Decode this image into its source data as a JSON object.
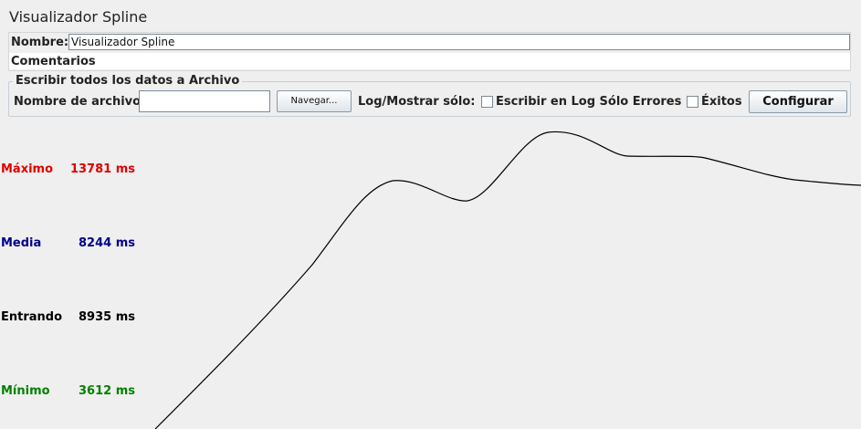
{
  "window": {
    "title": "Visualizador Spline"
  },
  "name_section": {
    "name_label": "Nombre:",
    "name_value": "Visualizador Spline",
    "comments_label": "Comentarios"
  },
  "write_all": {
    "legend": "Escribir todos los datos a Archivo",
    "filename_label": "Nombre de archivo",
    "filename_value": "",
    "browse_label": "Navegar...",
    "log_show_label": "Log/Mostrar sólo:",
    "errors_label": "Escribir en Log Sólo Errores",
    "errors_checked": false,
    "success_label": "Éxitos",
    "success_checked": false,
    "configure_label": "Configurar"
  },
  "stats": [
    {
      "label": "Máximo",
      "value": "13781 ms",
      "color": "#e00000"
    },
    {
      "label": "Media",
      "value": "8244 ms",
      "color": "#00008b"
    },
    {
      "label": "Entrando",
      "value": "8935 ms",
      "color": "#000000"
    },
    {
      "label": "Mínimo",
      "value": "3612 ms",
      "color": "#008000"
    }
  ]
}
